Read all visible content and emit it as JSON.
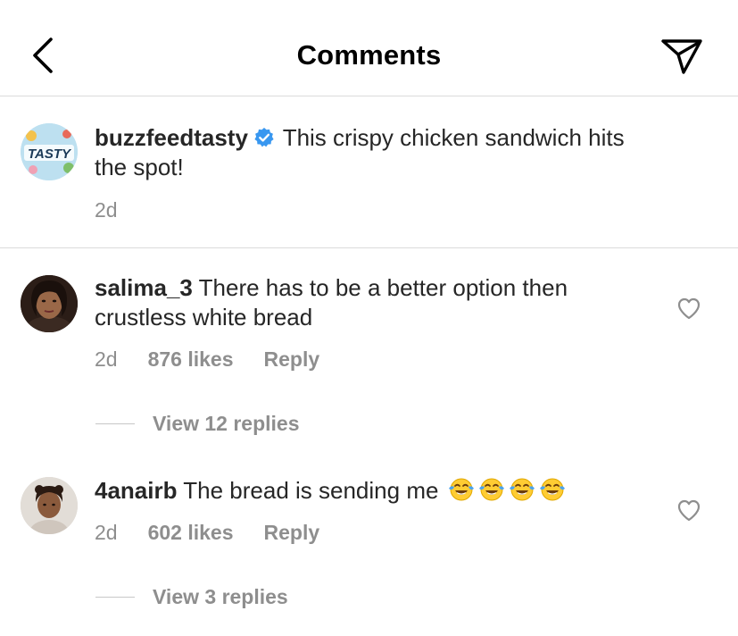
{
  "header": {
    "title": "Comments",
    "back_icon": "chevron-left-icon",
    "send_icon": "paper-plane-icon"
  },
  "caption": {
    "username": "buzzfeedtasty",
    "verified": true,
    "text": "This crispy chicken sandwich hits",
    "text_line2": "the spot!",
    "time": "2d",
    "avatar_label": "TASTY"
  },
  "comments": [
    {
      "username": "salima_3",
      "text": "There has to be a better option then",
      "text_line2": "crustless white bread",
      "time": "2d",
      "likes": "876 likes",
      "reply_label": "Reply",
      "view_replies": "View 12 replies"
    },
    {
      "username": "4anairb",
      "text": "The bread is sending me",
      "emoji_count": 4,
      "emoji_name": "face-with-tears-of-joy",
      "time": "2d",
      "likes": "602 likes",
      "reply_label": "Reply",
      "view_replies": "View 3 replies"
    }
  ],
  "colors": {
    "text": "#262626",
    "secondary": "#8e8e8e",
    "divider": "#dbdbdb",
    "verified": "#3897f0"
  }
}
